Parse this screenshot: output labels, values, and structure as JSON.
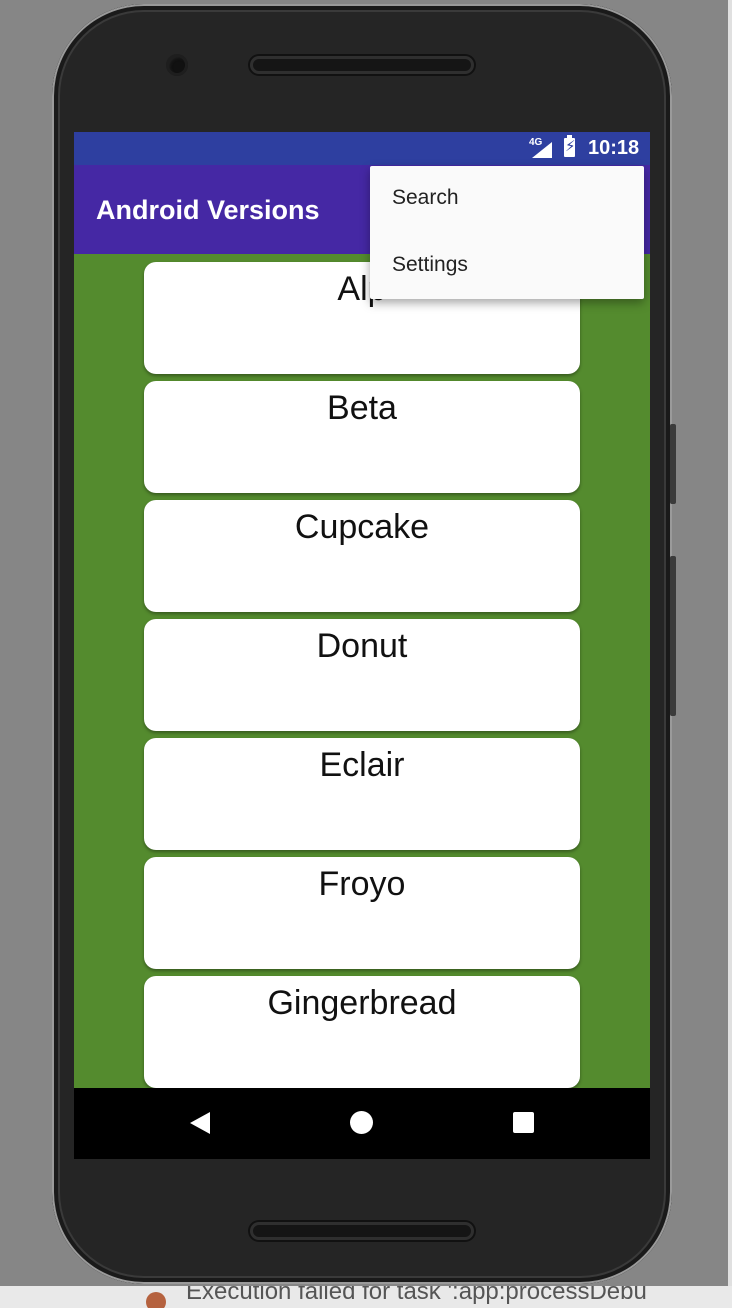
{
  "status_bar": {
    "network": "4G",
    "time": "10:18",
    "icons": [
      "signal-icon",
      "battery-charging-icon"
    ]
  },
  "app_bar": {
    "title": "Android Versions"
  },
  "overflow_menu": {
    "items": [
      {
        "label": "Search"
      },
      {
        "label": "Settings"
      }
    ]
  },
  "versions": [
    {
      "name": "Alpha",
      "visible": "Alp"
    },
    {
      "name": "Beta"
    },
    {
      "name": "Cupcake"
    },
    {
      "name": "Donut"
    },
    {
      "name": "Eclair"
    },
    {
      "name": "Froyo"
    },
    {
      "name": "Gingerbread"
    }
  ],
  "nav_bar": {
    "icons": [
      "back-icon",
      "home-icon",
      "recents-icon"
    ]
  },
  "ide_message": {
    "text": "Execution failed for task ':app:processDebu"
  },
  "colors": {
    "status_bar": "#2e3fa0",
    "app_bar": "#4528a4",
    "list_background": "#548b2e",
    "card": "#ffffff"
  }
}
